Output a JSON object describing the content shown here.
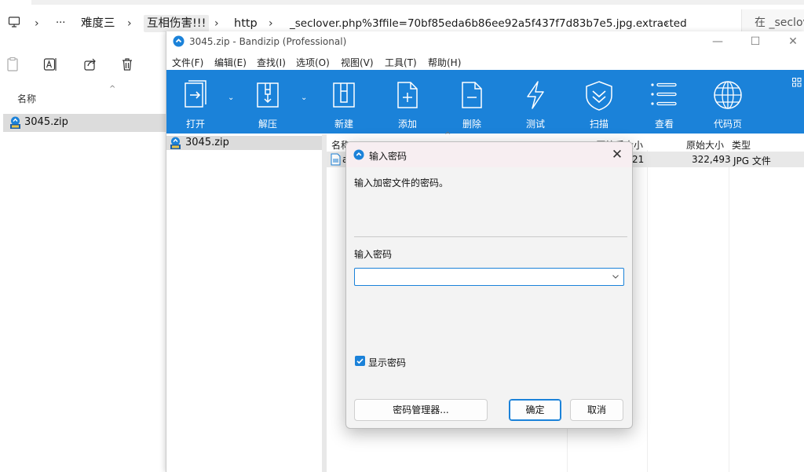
{
  "explorer": {
    "breadcrumbs": [
      "难度三",
      "互相伤害!!!",
      "http",
      "_seclover.php%3ffile=70bf85eda6b86ee92a5f437f7d83b7e5.jpg.extracted"
    ],
    "ellipsis": "···",
    "search_placeholder": "在 _seclov",
    "column_name": "名称",
    "file_name": "3045.zip"
  },
  "bandizip": {
    "title": "3045.zip - Bandizip (Professional)",
    "menu": [
      "文件(F)",
      "编辑(E)",
      "查找(I)",
      "选项(O)",
      "视图(V)",
      "工具(T)",
      "帮助(H)"
    ],
    "toolbar": [
      {
        "label": "打开",
        "icon": "open-icon"
      },
      {
        "label": "解压",
        "icon": "extract-icon"
      },
      {
        "label": "新建",
        "icon": "new-archive-icon"
      },
      {
        "label": "添加",
        "icon": "add-icon"
      },
      {
        "label": "删除",
        "icon": "delete-icon"
      },
      {
        "label": "测试",
        "icon": "test-icon"
      },
      {
        "label": "扫描",
        "icon": "scan-icon"
      },
      {
        "label": "查看",
        "icon": "view-icon"
      },
      {
        "label": "代码页",
        "icon": "codepage-icon"
      }
    ],
    "tree_item": "3045.zip",
    "columns": {
      "name": "名称",
      "compressed": "压缩后大小",
      "original": "原始大小",
      "type": "类型"
    },
    "rows": [
      {
        "name": "a",
        "compressed": "21",
        "original": "322,493",
        "type": "JPG 文件"
      }
    ],
    "accent_color": "#1b82d9"
  },
  "dialog": {
    "title": "输入密码",
    "message": "输入加密文件的密码。",
    "password_label": "输入密码",
    "password_value": "",
    "show_password_label": "显示密码",
    "show_password_checked": true,
    "manager_button": "密码管理器...",
    "ok_button": "确定",
    "cancel_button": "取消"
  }
}
